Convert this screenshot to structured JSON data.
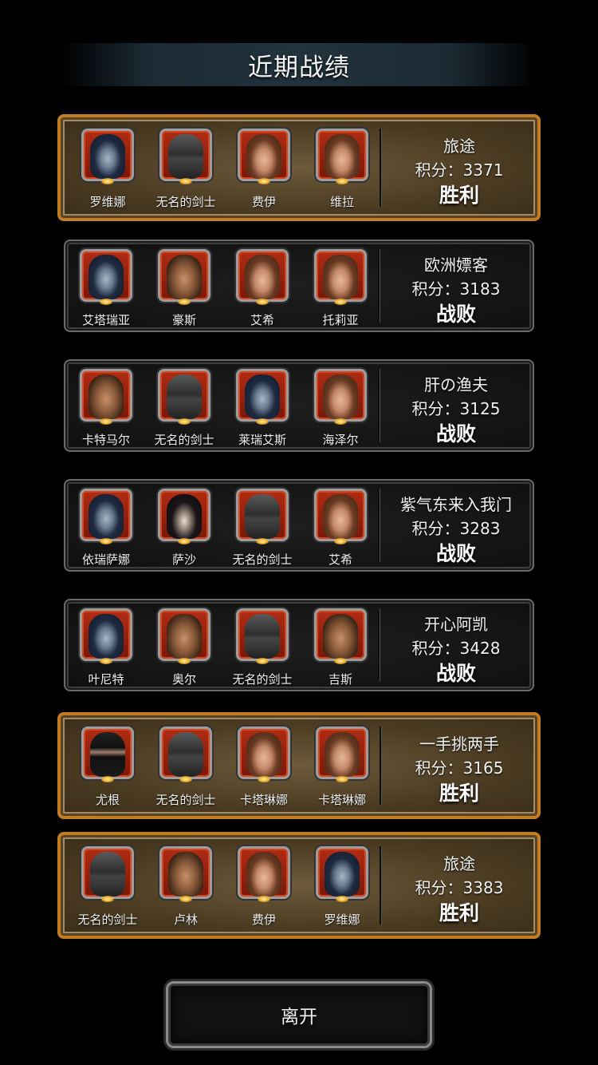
{
  "header": {
    "title": "近期战绩"
  },
  "records": [
    {
      "style": "win",
      "opponent": "旅途",
      "score": "积分：3371",
      "result": "胜利",
      "heroes": [
        {
          "name": "罗维娜",
          "portrait": "hood"
        },
        {
          "name": "无名的剑士",
          "portrait": "helm"
        },
        {
          "name": "费伊",
          "portrait": "girl"
        },
        {
          "name": "维拉",
          "portrait": "girl"
        }
      ]
    },
    {
      "style": "loss",
      "opponent": "欧洲嫖客",
      "score": "积分：3183",
      "result": "战败",
      "heroes": [
        {
          "name": "艾塔瑞亚",
          "portrait": "hood"
        },
        {
          "name": "豪斯",
          "portrait": "man"
        },
        {
          "name": "艾希",
          "portrait": "girl"
        },
        {
          "name": "托莉亚",
          "portrait": "girl"
        }
      ]
    },
    {
      "style": "loss",
      "opponent": "肝の渔夫",
      "score": "积分：3125",
      "result": "战败",
      "heroes": [
        {
          "name": "卡特马尔",
          "portrait": "man"
        },
        {
          "name": "无名的剑士",
          "portrait": "helm"
        },
        {
          "name": "莱瑞艾斯",
          "portrait": "hood"
        },
        {
          "name": "海泽尔",
          "portrait": "girl"
        }
      ]
    },
    {
      "style": "loss",
      "opponent": "紫气东来入我门",
      "score": "积分：3283",
      "result": "战败",
      "heroes": [
        {
          "name": "依瑞萨娜",
          "portrait": "hood"
        },
        {
          "name": "萨沙",
          "portrait": "dark"
        },
        {
          "name": "无名的剑士",
          "portrait": "helm"
        },
        {
          "name": "艾希",
          "portrait": "girl"
        }
      ]
    },
    {
      "style": "loss",
      "opponent": "开心阿凯",
      "score": "积分：3428",
      "result": "战败",
      "heroes": [
        {
          "name": "叶尼特",
          "portrait": "hood"
        },
        {
          "name": "奥尔",
          "portrait": "man"
        },
        {
          "name": "无名的剑士",
          "portrait": "helm"
        },
        {
          "name": "吉斯",
          "portrait": "man"
        }
      ]
    },
    {
      "style": "win",
      "opponent": "一手挑两手",
      "score": "积分：3165",
      "result": "胜利",
      "heroes": [
        {
          "name": "尤根",
          "portrait": "ninja"
        },
        {
          "name": "无名的剑士",
          "portrait": "helm"
        },
        {
          "name": "卡塔琳娜",
          "portrait": "girl"
        },
        {
          "name": "卡塔琳娜",
          "portrait": "girl"
        }
      ]
    },
    {
      "style": "win",
      "opponent": "旅途",
      "score": "积分：3383",
      "result": "胜利",
      "heroes": [
        {
          "name": "无名的剑士",
          "portrait": "helm"
        },
        {
          "name": "卢林",
          "portrait": "man"
        },
        {
          "name": "费伊",
          "portrait": "girl"
        },
        {
          "name": "罗维娜",
          "portrait": "hood"
        }
      ]
    }
  ],
  "footer": {
    "leave_label": "离开"
  }
}
